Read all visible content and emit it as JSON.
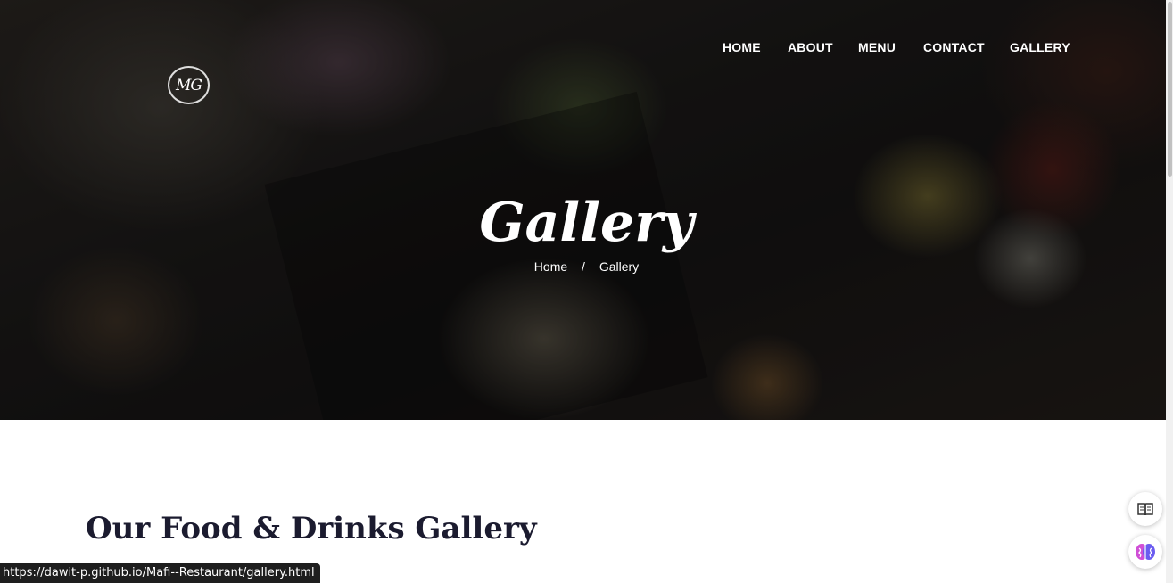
{
  "header": {
    "logo_text": "MG",
    "nav": [
      {
        "label": "HOME"
      },
      {
        "label": "ABOUT"
      },
      {
        "label": "MENU"
      },
      {
        "label": "CONTACT"
      },
      {
        "label": "GALLERY"
      }
    ]
  },
  "hero": {
    "title": "Gallery",
    "breadcrumb": {
      "home": "Home",
      "separator": "/",
      "current": "Gallery"
    }
  },
  "main": {
    "section_title": "Our Food & Drinks Gallery"
  },
  "floating_actions": {
    "reader_icon": "open-book-icon",
    "assistant_icon": "brain-icon"
  },
  "status_bar": {
    "url": "https://dawit-p.github.io/Mafi--Restaurant/gallery.html"
  },
  "colors": {
    "heading": "#1b1b2f",
    "hero_text": "#ffffff",
    "accent": "#e8a23a"
  }
}
